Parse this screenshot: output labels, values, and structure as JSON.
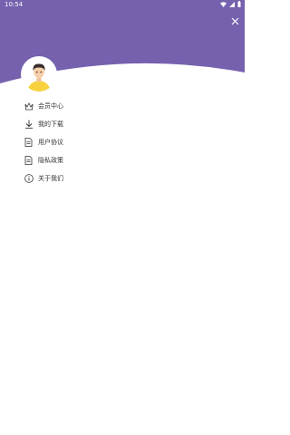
{
  "status_bar": {
    "time": "10:54",
    "icons": [
      "wifi-icon",
      "signal-icon",
      "battery-icon"
    ]
  },
  "header": {
    "background_color": "#7561ae",
    "close_icon": "close-icon"
  },
  "profile": {
    "avatar_icon": "avatar-icon"
  },
  "menu": {
    "items": [
      {
        "label": "会员中心",
        "icon": "crown-icon"
      },
      {
        "label": "我的下载",
        "icon": "download-icon"
      },
      {
        "label": "用户协议",
        "icon": "document-icon"
      },
      {
        "label": "隐私政策",
        "icon": "document-icon"
      },
      {
        "label": "关于我们",
        "icon": "info-icon"
      }
    ]
  }
}
